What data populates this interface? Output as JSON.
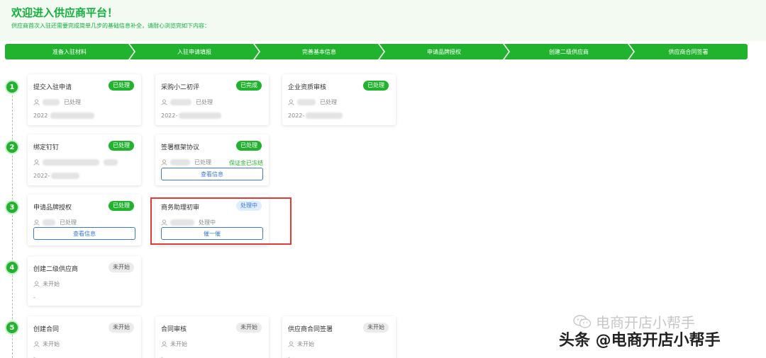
{
  "header": {
    "title": "欢迎进入供应商平台！",
    "subtitle": "供应商首次入驻还需要完成简单几步的基础信息补全，请耐心浏览完如下内容："
  },
  "steps": [
    "准备入驻材料",
    "入驻申请填报",
    "完善基本信息",
    "申请品牌授权",
    "创建二级供应商",
    "供应商合同签署"
  ],
  "rows": [
    {
      "num": "1",
      "cards": [
        {
          "title": "提交入驻申请",
          "badge": "已处理",
          "status": "已处理",
          "date": "2022"
        },
        {
          "title": "采购小二初评",
          "badge": "已完成",
          "status": "已处理",
          "date": "2022-"
        },
        {
          "title": "企业资质审核",
          "badge": "已处理",
          "status": "已处理",
          "date": "2022-"
        }
      ]
    },
    {
      "num": "2",
      "cards": [
        {
          "title": "绑定钉钉",
          "badge": "已处理",
          "status": "",
          "date": "2022-"
        },
        {
          "title": "签署框架协议",
          "badge": "已处理",
          "status": "已处理",
          "tag": "保证金已冻结",
          "button": "查看信息"
        }
      ]
    },
    {
      "num": "3",
      "cards": [
        {
          "title": "申请品牌授权",
          "badge": "已处理",
          "status": "已处理",
          "button": "查看信息"
        },
        {
          "title": "商务助理初审",
          "badge": "处理中",
          "status": "处理中",
          "button": "催一催"
        }
      ]
    },
    {
      "num": "4",
      "cards": [
        {
          "title": "创建二级供应商",
          "badge": "未开始",
          "status": "未开始",
          "date": "-"
        }
      ]
    },
    {
      "num": "5",
      "cards": [
        {
          "title": "创建合同",
          "badge": "未开始",
          "status": "未开始",
          "date": "-"
        },
        {
          "title": "合同审核",
          "badge": "未开始",
          "status": "未开始",
          "date": "-"
        },
        {
          "title": "供应商合同签署",
          "badge": "未开始",
          "status": "未开始",
          "date": "-"
        }
      ]
    }
  ],
  "watermark": {
    "account": "电商开店小帮手",
    "source": "头条 @电商开店小帮手"
  },
  "colors": {
    "primary": "#21b32e",
    "blue": "#3a7bd5",
    "highlight": "#e53935"
  }
}
